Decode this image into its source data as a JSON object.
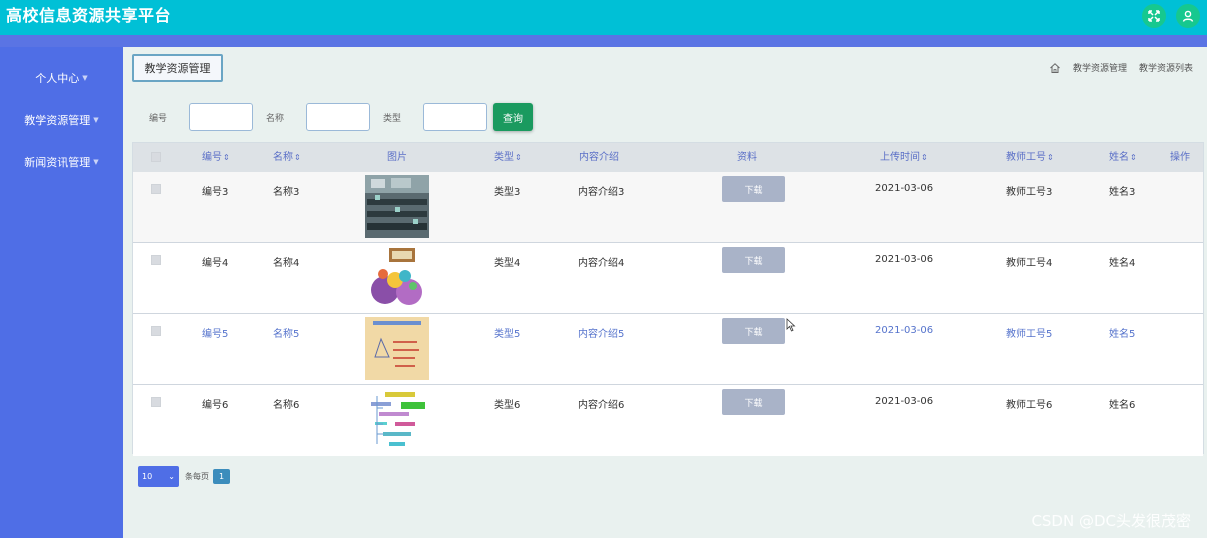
{
  "app": {
    "title": "高校信息资源共享平台"
  },
  "header": {
    "icons": [
      "expand-icon",
      "user-icon"
    ]
  },
  "sidebar": {
    "items": [
      {
        "label": "个人中心"
      },
      {
        "label": "教学资源管理"
      },
      {
        "label": "新闻资讯管理"
      }
    ]
  },
  "page": {
    "section_label": "教学资源管理",
    "breadcrumb": [
      "教学资源管理",
      "教学资源列表"
    ]
  },
  "search": {
    "fields": [
      {
        "label": "编号",
        "value": ""
      },
      {
        "label": "名称",
        "value": ""
      },
      {
        "label": "类型",
        "value": ""
      }
    ],
    "button_label": "查询"
  },
  "table": {
    "columns": [
      {
        "label": "编号",
        "sortable": true
      },
      {
        "label": "名称",
        "sortable": true
      },
      {
        "label": "图片",
        "sortable": false
      },
      {
        "label": "类型",
        "sortable": true
      },
      {
        "label": "内容介绍",
        "sortable": false
      },
      {
        "label": "资料",
        "sortable": false
      },
      {
        "label": "上传时间",
        "sortable": true
      },
      {
        "label": "教师工号",
        "sortable": true
      },
      {
        "label": "姓名",
        "sortable": true
      },
      {
        "label": "操作",
        "sortable": false
      }
    ],
    "sort_icon": "⇕",
    "rows": [
      {
        "id": "编号3",
        "name": "名称3",
        "type": "类型3",
        "intro": "内容介绍3",
        "download": "下载",
        "time": "2021-03-06",
        "teacher_no": "教师工号3",
        "teacher": "姓名3"
      },
      {
        "id": "编号4",
        "name": "名称4",
        "type": "类型4",
        "intro": "内容介绍4",
        "download": "下载",
        "time": "2021-03-06",
        "teacher_no": "教师工号4",
        "teacher": "姓名4"
      },
      {
        "id": "编号5",
        "name": "名称5",
        "type": "类型5",
        "intro": "内容介绍5",
        "download": "下载",
        "time": "2021-03-06",
        "teacher_no": "教师工号5",
        "teacher": "姓名5"
      },
      {
        "id": "编号6",
        "name": "名称6",
        "type": "类型6",
        "intro": "内容介绍6",
        "download": "下载",
        "time": "2021-03-06",
        "teacher_no": "教师工号6",
        "teacher": "姓名6"
      }
    ]
  },
  "pagination": {
    "page_size": "10",
    "per_page_label": "条每页",
    "current_page": "1"
  },
  "watermark": "CSDN @DC头发很茂密",
  "colors": {
    "topbar": "#00c0d6",
    "sidebar": "#4f6ee6",
    "search_button": "#1a9a5f",
    "header_icon": "#16c88f",
    "link_blue": "#5a6fc7"
  }
}
